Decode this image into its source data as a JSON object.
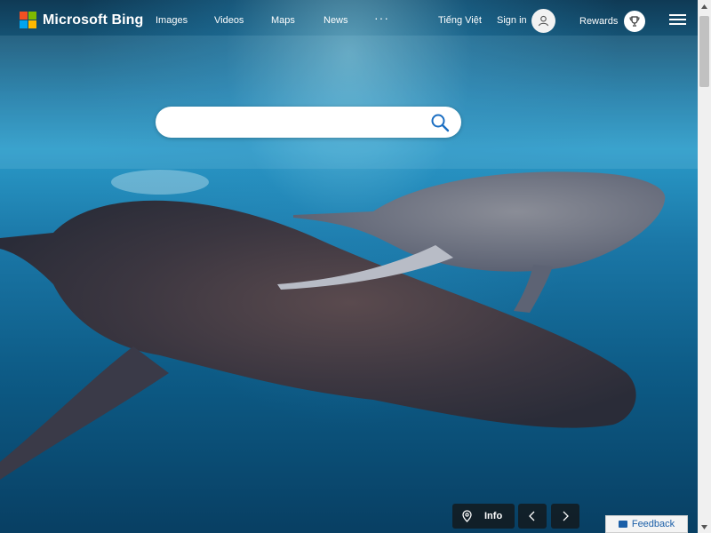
{
  "brand": {
    "name": "Microsoft Bing",
    "colors": [
      "#f25022",
      "#7fba00",
      "#00a4ef",
      "#ffb900"
    ]
  },
  "nav": {
    "items": [
      "Images",
      "Videos",
      "Maps",
      "News"
    ],
    "more": "···"
  },
  "header": {
    "language": "Tiếng Việt",
    "signin": "Sign in",
    "rewards": "Rewards"
  },
  "search": {
    "value": "",
    "placeholder": ""
  },
  "controls": {
    "info": "Info",
    "feedback": "Feedback"
  },
  "background": {
    "scene": "humpback whale and calf underwater"
  }
}
